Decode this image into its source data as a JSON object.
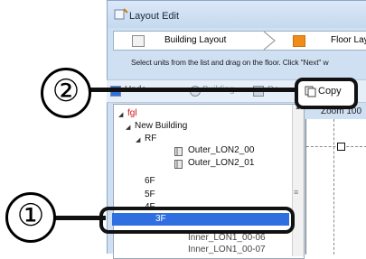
{
  "window": {
    "title": "Layout Edit"
  },
  "steps": [
    {
      "label": "Building Layout"
    },
    {
      "label": "Floor Layout"
    }
  ],
  "instruction": "Select units from the list and drag on the floor. Click \"Next\" w",
  "toolbar": {
    "item_a": "Unde",
    "item_b": "Building",
    "item_c": "De",
    "copy_label": "Copy"
  },
  "tree": {
    "root": "fgl",
    "building": "New Building",
    "floors": [
      "RF",
      "6F",
      "5F",
      "4F",
      "3F"
    ],
    "units_rf": [
      "Outer_LON2_00",
      "Outer_LON2_01"
    ],
    "units_3f": [
      "Inner_LON1_00-06",
      "Inner_LON1_00-07"
    ]
  },
  "zoom_label": "Zoom 100",
  "callouts": [
    "②",
    "①"
  ],
  "colors": {
    "accent_orange": "#f08c18",
    "selection_blue": "#2f6fe0"
  }
}
